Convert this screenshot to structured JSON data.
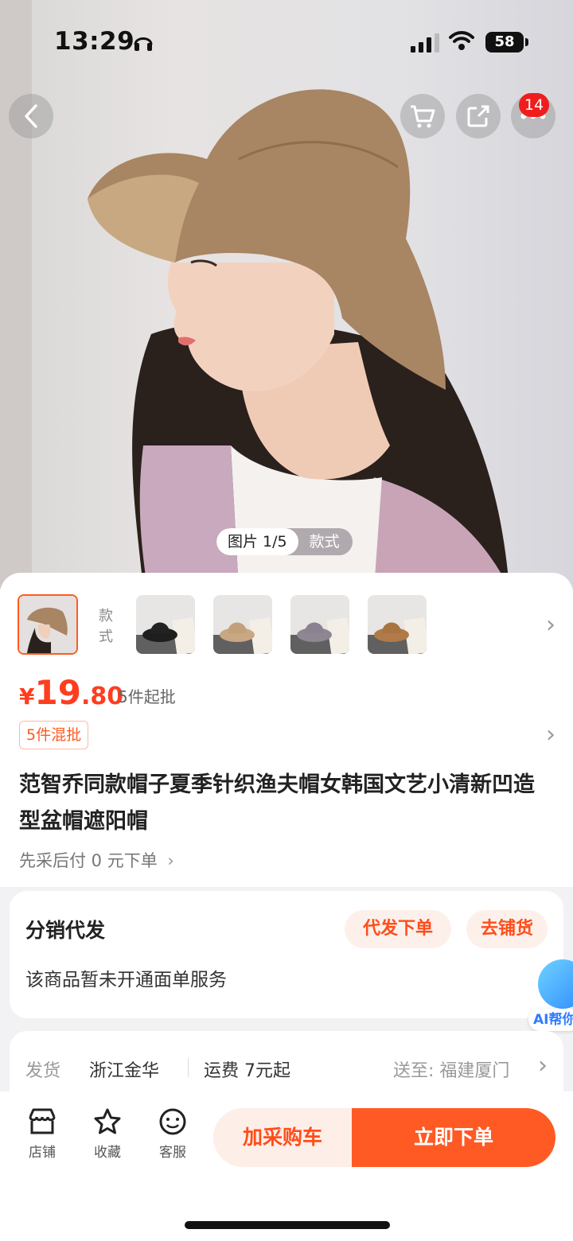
{
  "status_bar": {
    "time": "13:29",
    "battery": "58"
  },
  "nav": {
    "cart_badge": "14"
  },
  "gallery": {
    "counter_current": "图片 1/5",
    "counter_style": "款式"
  },
  "variants": {
    "label": "款式",
    "count": 5
  },
  "price": {
    "currency": "¥",
    "integer": "19",
    "decimal": ".80",
    "moq": "5件起批"
  },
  "tag_mix": "5件混批",
  "product_title": "范智乔同款帽子夏季针织渔夫帽女韩国文艺小清新凹造型盆帽遮阳帽",
  "pay_later": "先采后付 0 元下单",
  "distribution": {
    "title": "分销代发",
    "btn_dropship": "代发下单",
    "btn_stock": "去铺货",
    "note": "该商品暂未开通面单服务"
  },
  "ai_assistant": {
    "label": "AI帮你"
  },
  "shipping": {
    "label": "发货",
    "origin": "浙江金华",
    "fee": "运费 7元起",
    "destination": "送至:  福建厦门"
  },
  "bottom_bar": {
    "shop": "店铺",
    "favorite": "收藏",
    "service": "客服",
    "add_cart": "加采购车",
    "buy_now": "立即下单"
  },
  "colors": {
    "accent": "#ff5a24",
    "price": "#ff3d1f",
    "badge": "#f01d1d"
  }
}
